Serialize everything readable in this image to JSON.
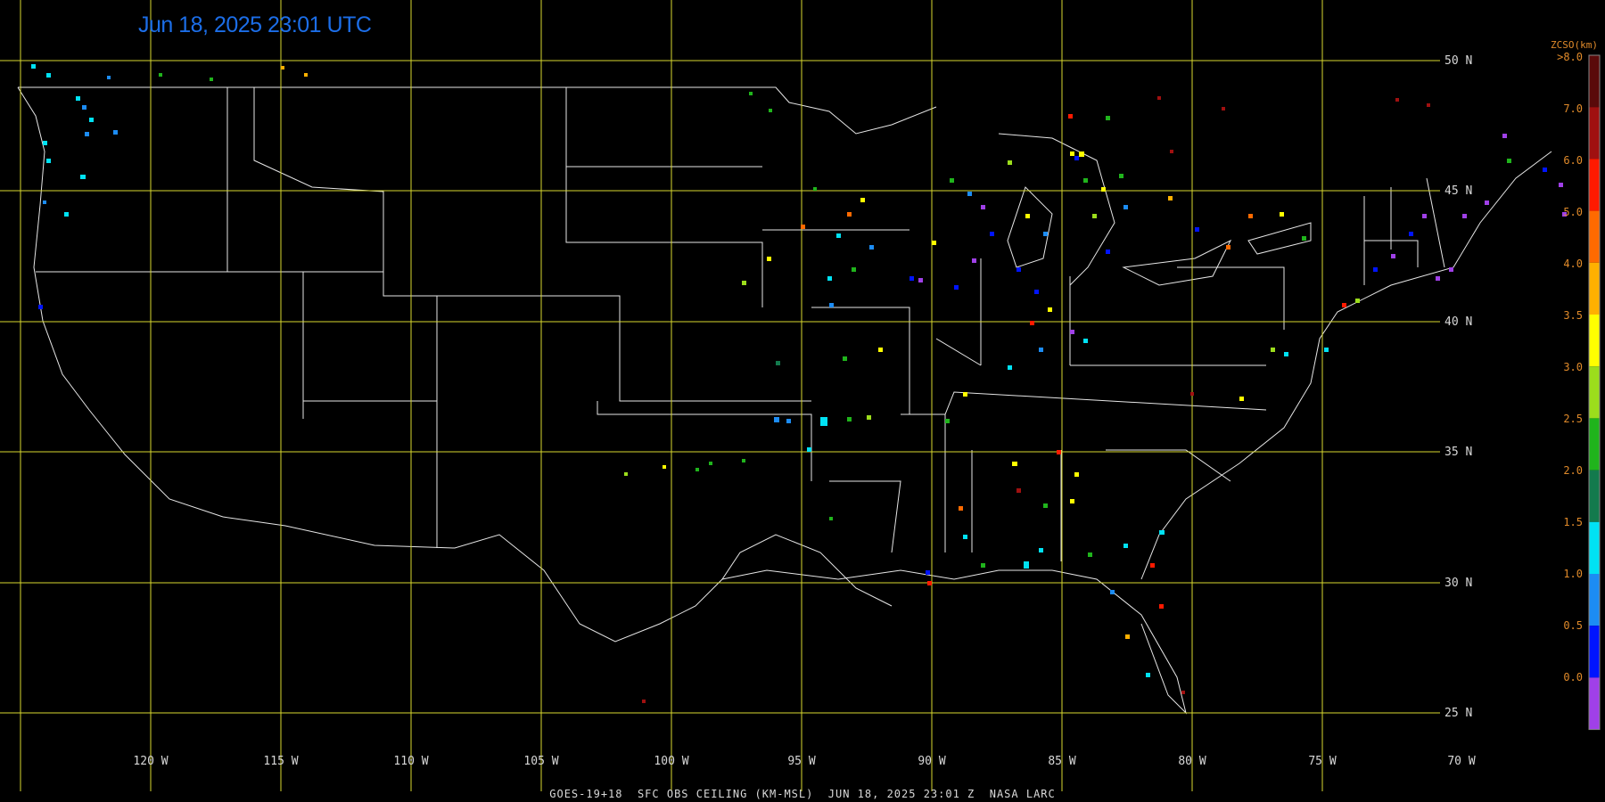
{
  "timestamp": "Jun 18, 2025 23:01 UTC",
  "footer": "GOES-19+18  SFC OBS CEILING (KM-MSL)  JUN 18, 2025 23:01 Z  NASA LARC",
  "lat_labels": [
    "50 N",
    "45 N",
    "40 N",
    "35 N",
    "30 N",
    "25 N"
  ],
  "lon_labels": [
    "120 W",
    "115 W",
    "110 W",
    "105 W",
    "100 W",
    "95 W",
    "90 W",
    "85 W",
    "80 W",
    "75 W",
    "70 W"
  ],
  "legend": {
    "title": "ZCSO(km)",
    "top_label": ">8.0",
    "labels": [
      "7.0",
      "6.0",
      "5.0",
      "4.0",
      "3.5",
      "3.0",
      "2.5",
      "2.0",
      "1.5",
      "1.0",
      "0.5",
      "0.0"
    ],
    "colors": [
      "#5a0a0a",
      "#a01010",
      "#ff1a00",
      "#ff6a00",
      "#ffb000",
      "#ffff00",
      "#9cdd1c",
      "#20b41c",
      "#137a4d",
      "#00e2f4",
      "#1c8cf4",
      "#0014ff",
      "#a040e8"
    ]
  },
  "colors": {
    "grid": "#d8d830",
    "boundary": "#e6e6e6",
    "timestamp": "#1c6ee8",
    "legend_text": "#e08a2a"
  }
}
